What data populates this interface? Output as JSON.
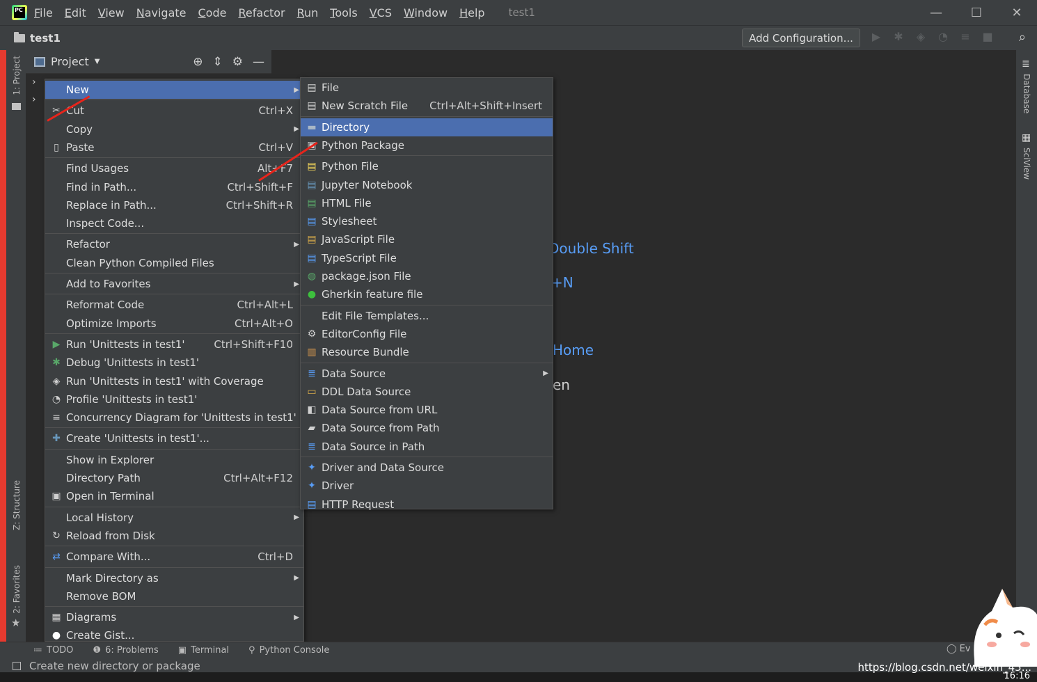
{
  "app": {
    "logo_text": "PC",
    "window_title": "test1",
    "menu": [
      "File",
      "Edit",
      "View",
      "Navigate",
      "Code",
      "Refactor",
      "Run",
      "Tools",
      "VCS",
      "Window",
      "Help"
    ],
    "win_minimize": "—",
    "win_maximize": "☐",
    "win_close": "✕"
  },
  "navbar": {
    "breadcrumb": "test1",
    "add_configuration": "Add Configuration..."
  },
  "side_tabs": {
    "project": "1: Project",
    "structure": "Z: Structure",
    "favorites": "2: Favorites",
    "database": "Database",
    "sciview": "SciView"
  },
  "project_panel": {
    "title": "Project"
  },
  "editor_hints": {
    "double_shift": "Double Shift",
    "n": "+N",
    "home": "Home",
    "en": "en"
  },
  "context_menu": {
    "items": [
      {
        "label": "New",
        "shortcut": "",
        "submenu": true,
        "selected": true,
        "icon": ""
      },
      {
        "label": "Cut",
        "shortcut": "Ctrl+X",
        "submenu": false,
        "icon": "scissors-icon"
      },
      {
        "label": "Copy",
        "shortcut": "",
        "submenu": true,
        "icon": ""
      },
      {
        "label": "Paste",
        "shortcut": "Ctrl+V",
        "submenu": false,
        "icon": "clipboard-icon"
      },
      {
        "label": "Find Usages",
        "shortcut": "Alt+F7",
        "submenu": false,
        "icon": ""
      },
      {
        "label": "Find in Path...",
        "shortcut": "Ctrl+Shift+F",
        "submenu": false,
        "icon": ""
      },
      {
        "label": "Replace in Path...",
        "shortcut": "Ctrl+Shift+R",
        "submenu": false,
        "icon": ""
      },
      {
        "label": "Inspect Code...",
        "shortcut": "",
        "submenu": false,
        "icon": ""
      },
      {
        "label": "Refactor",
        "shortcut": "",
        "submenu": true,
        "icon": ""
      },
      {
        "label": "Clean Python Compiled Files",
        "shortcut": "",
        "submenu": false,
        "icon": ""
      },
      {
        "label": "Add to Favorites",
        "shortcut": "",
        "submenu": true,
        "icon": ""
      },
      {
        "label": "Reformat Code",
        "shortcut": "Ctrl+Alt+L",
        "submenu": false,
        "icon": ""
      },
      {
        "label": "Optimize Imports",
        "shortcut": "Ctrl+Alt+O",
        "submenu": false,
        "icon": ""
      },
      {
        "label": "Run 'Unittests in test1'",
        "shortcut": "Ctrl+Shift+F10",
        "submenu": false,
        "icon": "run-icon"
      },
      {
        "label": "Debug 'Unittests in test1'",
        "shortcut": "",
        "submenu": false,
        "icon": "debug-icon"
      },
      {
        "label": "Run 'Unittests in test1' with Coverage",
        "shortcut": "",
        "submenu": false,
        "icon": "coverage-icon"
      },
      {
        "label": "Profile 'Unittests in test1'",
        "shortcut": "",
        "submenu": false,
        "icon": "profile-icon"
      },
      {
        "label": "Concurrency Diagram for 'Unittests in test1'",
        "shortcut": "",
        "submenu": false,
        "icon": "concurrency-icon"
      },
      {
        "label": "Create 'Unittests in test1'...",
        "shortcut": "",
        "submenu": false,
        "icon": "create-config-icon"
      },
      {
        "label": "Show in Explorer",
        "shortcut": "",
        "submenu": false,
        "icon": ""
      },
      {
        "label": "Directory Path",
        "shortcut": "Ctrl+Alt+F12",
        "submenu": false,
        "icon": ""
      },
      {
        "label": "Open in Terminal",
        "shortcut": "",
        "submenu": false,
        "icon": "terminal-icon"
      },
      {
        "label": "Local History",
        "shortcut": "",
        "submenu": true,
        "icon": ""
      },
      {
        "label": "Reload from Disk",
        "shortcut": "",
        "submenu": false,
        "icon": "reload-icon"
      },
      {
        "label": "Compare With...",
        "shortcut": "Ctrl+D",
        "submenu": false,
        "icon": "compare-icon"
      },
      {
        "label": "Mark Directory as",
        "shortcut": "",
        "submenu": true,
        "icon": ""
      },
      {
        "label": "Remove BOM",
        "shortcut": "",
        "submenu": false,
        "icon": ""
      },
      {
        "label": "Diagrams",
        "shortcut": "",
        "submenu": true,
        "icon": "diagram-icon"
      },
      {
        "label": "Create Gist...",
        "shortcut": "",
        "submenu": false,
        "icon": "github-icon"
      }
    ]
  },
  "new_submenu": {
    "items": [
      {
        "label": "File",
        "shortcut": "",
        "icon": "file-icon"
      },
      {
        "label": "New Scratch File",
        "shortcut": "Ctrl+Alt+Shift+Insert",
        "icon": "scratch-file-icon"
      },
      {
        "label": "Directory",
        "shortcut": "",
        "icon": "folder-icon",
        "selected": true
      },
      {
        "label": "Python Package",
        "shortcut": "",
        "icon": "python-package-icon"
      },
      {
        "label": "Python File",
        "shortcut": "",
        "icon": "python-file-icon"
      },
      {
        "label": "Jupyter Notebook",
        "shortcut": "",
        "icon": "jupyter-icon"
      },
      {
        "label": "HTML File",
        "shortcut": "",
        "icon": "html-file-icon"
      },
      {
        "label": "Stylesheet",
        "shortcut": "",
        "icon": "css-file-icon"
      },
      {
        "label": "JavaScript File",
        "shortcut": "",
        "icon": "js-file-icon"
      },
      {
        "label": "TypeScript File",
        "shortcut": "",
        "icon": "ts-file-icon"
      },
      {
        "label": "package.json File",
        "shortcut": "",
        "icon": "package-json-icon"
      },
      {
        "label": "Gherkin feature file",
        "shortcut": "",
        "icon": "gherkin-icon"
      },
      {
        "label": "Edit File Templates...",
        "shortcut": "",
        "icon": ""
      },
      {
        "label": "EditorConfig File",
        "shortcut": "",
        "icon": "gear-icon"
      },
      {
        "label": "Resource Bundle",
        "shortcut": "",
        "icon": "resource-bundle-icon"
      },
      {
        "label": "Data Source",
        "shortcut": "",
        "icon": "database-icon",
        "submenu": true
      },
      {
        "label": "DDL Data Source",
        "shortcut": "",
        "icon": "ddl-icon"
      },
      {
        "label": "Data Source from URL",
        "shortcut": "",
        "icon": "url-source-icon"
      },
      {
        "label": "Data Source from Path",
        "shortcut": "",
        "icon": "path-source-icon"
      },
      {
        "label": "Data Source in Path",
        "shortcut": "",
        "icon": "database-icon"
      },
      {
        "label": "Driver and Data Source",
        "shortcut": "",
        "icon": "driver-icon"
      },
      {
        "label": "Driver",
        "shortcut": "",
        "icon": "driver-icon"
      },
      {
        "label": "HTTP Request",
        "shortcut": "",
        "icon": "http-request-icon"
      }
    ]
  },
  "tool_windows": [
    "TODO",
    "6: Problems",
    "Terminal",
    "Python Console"
  ],
  "status": {
    "message": "Create new directory or package",
    "event_log": "Ev",
    "watermark": "https://blog.csdn.net/weixin_45...",
    "clock": "16:16"
  },
  "colors": {
    "selection": "#4b6eaf",
    "menu_bg": "#3c3f41",
    "editor_bg": "#2b2b2b",
    "hint_link": "#589df6",
    "annotation_arrow": "#e8241b"
  }
}
